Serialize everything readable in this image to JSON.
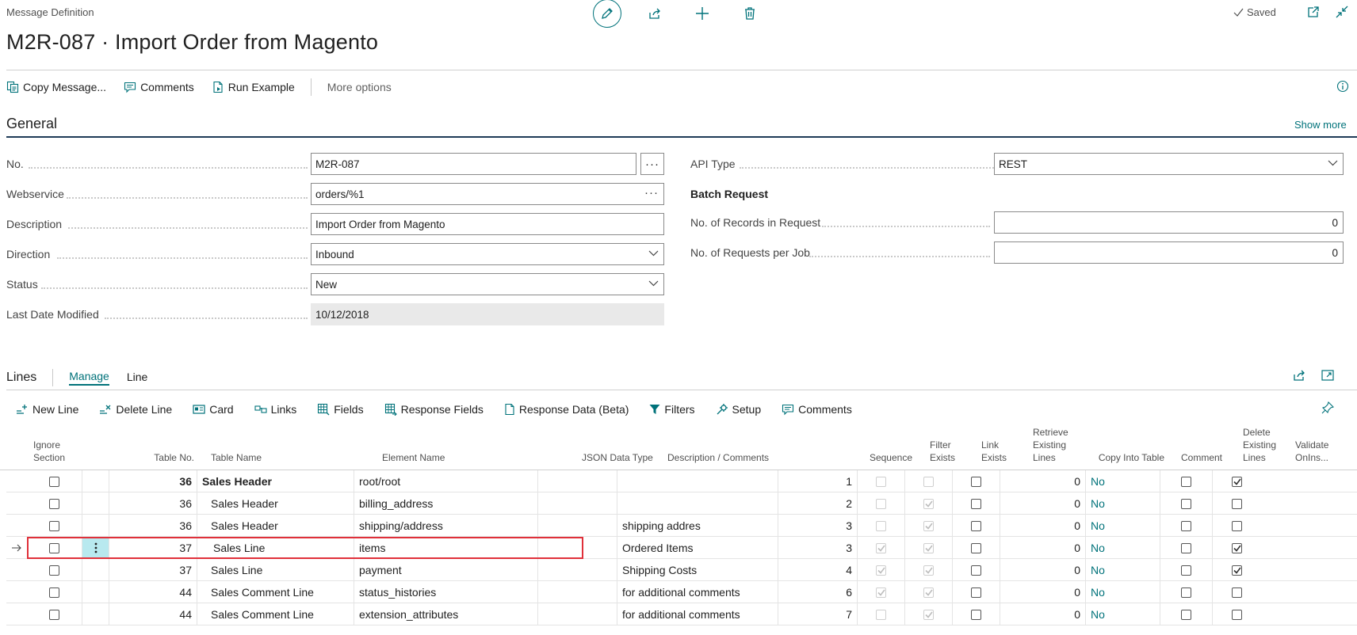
{
  "header": {
    "page_type": "Message Definition",
    "title": "M2R-087 · Import Order from Magento",
    "saved_label": "Saved"
  },
  "actions": {
    "copy_message": "Copy Message...",
    "comments": "Comments",
    "run_example": "Run Example",
    "more_options": "More options"
  },
  "general": {
    "title": "General",
    "show_more": "Show more",
    "fields": {
      "no": {
        "label": "No.",
        "value": "M2R-087"
      },
      "webservice": {
        "label": "Webservice",
        "value": "orders/%1"
      },
      "description": {
        "label": "Description",
        "value": "Import Order from Magento"
      },
      "direction": {
        "label": "Direction",
        "value": "Inbound"
      },
      "status": {
        "label": "Status",
        "value": "New"
      },
      "last_date_modified": {
        "label": "Last Date Modified",
        "value": "10/12/2018"
      },
      "api_type": {
        "label": "API Type",
        "value": "REST"
      },
      "batch_request": {
        "label": "Batch Request"
      },
      "records_in_request": {
        "label": "No. of Records in Request",
        "value": "0"
      },
      "requests_per_job": {
        "label": "No. of Requests per Job",
        "value": "0"
      }
    }
  },
  "lines": {
    "title": "Lines",
    "tabs": [
      "Manage",
      "Line"
    ],
    "actions": {
      "new_line": "New Line",
      "delete_line": "Delete Line",
      "card": "Card",
      "links": "Links",
      "fields": "Fields",
      "response_fields": "Response Fields",
      "response_data": "Response Data (Beta)",
      "filters": "Filters",
      "setup": "Setup",
      "comments": "Comments"
    },
    "columns": {
      "ignore_section": [
        "Ignore",
        "Section"
      ],
      "table_no": "Table No.",
      "table_name": "Table Name",
      "element_name": "Element Name",
      "json_data_type": "JSON Data Type",
      "description": "Description / Comments",
      "sequence": "Sequence",
      "filter_exists": [
        "Filter",
        "Exists"
      ],
      "link_exists": [
        "Link",
        "Exists"
      ],
      "retrieve_existing": [
        "Retrieve",
        "Existing",
        "Lines"
      ],
      "copy_into_table": "Copy Into Table",
      "comment": "Comment",
      "delete_existing": [
        "Delete",
        "Existing",
        "Lines"
      ],
      "validate": [
        "Validate",
        "OnIns..."
      ]
    },
    "rows": [
      {
        "ignore": false,
        "table_no": "36",
        "table_name": "Sales Header",
        "bold": true,
        "indent": false,
        "element": "root/root",
        "json": "",
        "desc": "",
        "seq": "1",
        "filter": false,
        "link": false,
        "retrieve": false,
        "copy": "0",
        "comment": "No",
        "delete": false,
        "validate": true
      },
      {
        "ignore": false,
        "table_no": "36",
        "table_name": "Sales Header",
        "bold": false,
        "indent": true,
        "element": "billing_address",
        "json": "",
        "desc": "",
        "seq": "2",
        "filter": false,
        "link": true,
        "retrieve": false,
        "copy": "0",
        "comment": "No",
        "delete": false,
        "validate": false
      },
      {
        "ignore": false,
        "table_no": "36",
        "table_name": "Sales Header",
        "bold": false,
        "indent": true,
        "element": "shipping/address",
        "json": "",
        "desc": "shipping addres",
        "seq": "3",
        "filter": false,
        "link": true,
        "retrieve": false,
        "copy": "0",
        "comment": "No",
        "delete": false,
        "validate": false
      },
      {
        "ignore": false,
        "table_no": "37",
        "table_name": "Sales Line",
        "bold": false,
        "indent": true,
        "element": "items",
        "json": "",
        "desc": "Ordered Items",
        "seq": "3",
        "filter": true,
        "link": true,
        "retrieve": false,
        "copy": "0",
        "comment": "No",
        "delete": false,
        "validate": true,
        "selected": true
      },
      {
        "ignore": false,
        "table_no": "37",
        "table_name": "Sales Line",
        "bold": false,
        "indent": true,
        "element": "payment",
        "json": "",
        "desc": "Shipping Costs",
        "seq": "4",
        "filter": true,
        "link": true,
        "retrieve": false,
        "copy": "0",
        "comment": "No",
        "delete": false,
        "validate": true
      },
      {
        "ignore": false,
        "table_no": "44",
        "table_name": "Sales Comment Line",
        "bold": false,
        "indent": true,
        "element": "status_histories",
        "json": "",
        "desc": "for additional comments",
        "seq": "6",
        "filter": true,
        "link": true,
        "retrieve": false,
        "copy": "0",
        "comment": "No",
        "delete": false,
        "validate": false
      },
      {
        "ignore": false,
        "table_no": "44",
        "table_name": "Sales Comment Line",
        "bold": false,
        "indent": true,
        "element": "extension_attributes",
        "json": "",
        "desc": "for additional comments",
        "seq": "7",
        "filter": false,
        "link": true,
        "retrieve": false,
        "copy": "0",
        "comment": "No",
        "delete": false,
        "validate": false
      }
    ]
  },
  "colors": {
    "accent": "#00727a",
    "selection": "#e0303a",
    "menu_cell": "#b8e9ef",
    "section_line": "#1f3b57"
  }
}
